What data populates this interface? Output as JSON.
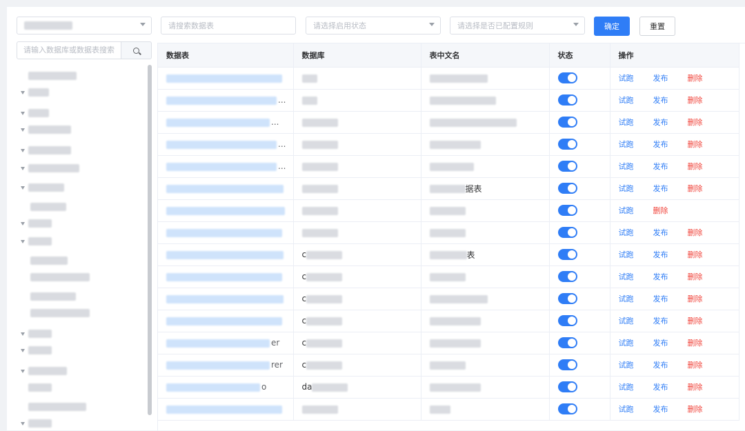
{
  "filters": {
    "search_table_placeholder": "请搜索数据表",
    "status_placeholder": "请选择启用状态",
    "rule_placeholder": "请选择是否已配置规则",
    "confirm_label": "确定",
    "reset_label": "重置"
  },
  "sidebar": {
    "search_placeholder": "请输入数据库或数据表搜索"
  },
  "table": {
    "headers": {
      "table": "数据表",
      "database": "数据库",
      "cn_name": "表中文名",
      "status": "状态",
      "action": "操作"
    },
    "rows": [
      {
        "name_tail": "",
        "db_prefix": "",
        "cn_tail": "",
        "actions": [
          "试跑",
          "发布",
          "删除"
        ]
      },
      {
        "name_tail": "...",
        "db_prefix": "",
        "cn_tail": "",
        "actions": [
          "试跑",
          "发布",
          "删除"
        ]
      },
      {
        "name_tail": "...",
        "db_prefix": "",
        "cn_tail": "",
        "actions": [
          "试跑",
          "发布",
          "删除"
        ]
      },
      {
        "name_tail": "...",
        "db_prefix": "",
        "cn_tail": "",
        "actions": [
          "试跑",
          "发布",
          "删除"
        ]
      },
      {
        "name_tail": "...",
        "db_prefix": "",
        "cn_tail": "",
        "actions": [
          "试跑",
          "发布",
          "删除"
        ]
      },
      {
        "name_tail": "",
        "db_prefix": "",
        "cn_tail": "据表",
        "actions": [
          "试跑",
          "发布",
          "删除"
        ]
      },
      {
        "name_tail": "",
        "db_prefix": "",
        "cn_tail": "",
        "actions": [
          "试跑",
          "删除"
        ]
      },
      {
        "name_tail": "",
        "db_prefix": "",
        "cn_tail": "",
        "actions": [
          "试跑",
          "发布",
          "删除"
        ]
      },
      {
        "name_tail": "",
        "db_prefix": "c",
        "cn_tail": "表",
        "actions": [
          "试跑",
          "发布",
          "删除"
        ]
      },
      {
        "name_tail": "",
        "db_prefix": "c",
        "cn_tail": "",
        "actions": [
          "试跑",
          "发布",
          "删除"
        ]
      },
      {
        "name_tail": "",
        "db_prefix": "c",
        "cn_tail": "",
        "actions": [
          "试跑",
          "发布",
          "删除"
        ]
      },
      {
        "name_tail": "",
        "db_prefix": "c",
        "cn_tail": "",
        "actions": [
          "试跑",
          "发布",
          "删除"
        ]
      },
      {
        "name_tail": "er",
        "db_prefix": "c",
        "cn_tail": "",
        "actions": [
          "试跑",
          "发布",
          "删除"
        ]
      },
      {
        "name_tail": "rer",
        "db_prefix": "c",
        "cn_tail": "",
        "actions": [
          "试跑",
          "发布",
          "删除"
        ]
      },
      {
        "name_tail": "o",
        "db_prefix": "da",
        "cn_tail": "",
        "actions": [
          "试跑",
          "发布",
          "删除"
        ]
      },
      {
        "name_tail": "",
        "db_prefix": "",
        "cn_tail": "",
        "actions": [
          "试跑",
          "发布",
          "删除"
        ]
      }
    ]
  },
  "colors": {
    "primary": "#2f7df6",
    "danger": "#f0433a"
  }
}
